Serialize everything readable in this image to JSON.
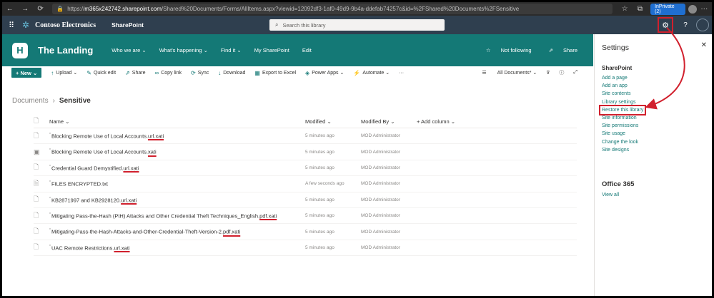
{
  "browser": {
    "url_host": "m365x242742.sharepoint.com",
    "url_path": "/Shared%20Documents/Forms/AllItems.aspx?viewid=12092df3-1af0-49d9-9b4a-ddefab74257c&id=%2FShared%20Documents%2FSensitive",
    "inprivate_label": "InPrivate (2)"
  },
  "suite": {
    "brand": "Contoso Electronics",
    "app": "SharePoint",
    "search_placeholder": "Search this library"
  },
  "site": {
    "logo_letter": "H",
    "title": "The Landing",
    "nav": [
      "Who we are",
      "What's happening",
      "Find it",
      "My SharePoint",
      "Edit"
    ],
    "follow_label": "Not following",
    "share_label": "Share"
  },
  "command_bar": {
    "new_label": "New",
    "commands": [
      "Upload",
      "Quick edit",
      "Share",
      "Copy link",
      "Sync",
      "Download",
      "Export to Excel",
      "Power Apps",
      "Automate",
      "···"
    ],
    "view_label": "All Documents*"
  },
  "breadcrumb": {
    "root": "Documents",
    "current": "Sensitive"
  },
  "table": {
    "headers": {
      "name": "Name",
      "modified": "Modified",
      "modified_by": "Modified By",
      "add_column": "+ Add column"
    },
    "rows": [
      {
        "base": "Blocking Remote Use of Local Accounts.",
        "ext": "url.xati",
        "modified": "5 minutes ago",
        "modified_by": "MOD Administrator",
        "icon": "file-icon"
      },
      {
        "base": "Blocking Remote Use of Local Accounts.",
        "ext": "xati",
        "modified": "5 minutes ago",
        "modified_by": "MOD Administrator",
        "icon": "image-file-icon"
      },
      {
        "base": "Credential Guard Demystified.",
        "ext": "url.xati",
        "modified": "5 minutes ago",
        "modified_by": "MOD Administrator",
        "icon": "file-icon"
      },
      {
        "base": "FILES ENCRYPTED.txt",
        "ext": "",
        "modified": "A few seconds ago",
        "modified_by": "MOD Administrator",
        "icon": "text-file-icon"
      },
      {
        "base": "KB2871997 and KB2928120.",
        "ext": "url.xati",
        "modified": "5 minutes ago",
        "modified_by": "MOD Administrator",
        "icon": "file-icon"
      },
      {
        "base": "Mitigating Pass-the-Hash (PtH) Attacks and Other Credential Theft Techniques_English.",
        "ext": "pdf.xati",
        "modified": "5 minutes ago",
        "modified_by": "MOD Administrator",
        "icon": "file-icon"
      },
      {
        "base": "Mitigating-Pass-the-Hash-Attacks-and-Other-Credential-Theft-Version-2.",
        "ext": "pdf.xati",
        "modified": "5 minutes ago",
        "modified_by": "MOD Administrator",
        "icon": "file-icon"
      },
      {
        "base": "UAC Remote Restrictions.",
        "ext": "url.xati",
        "modified": "5 minutes ago",
        "modified_by": "MOD Administrator",
        "icon": "file-icon"
      }
    ]
  },
  "settings": {
    "title": "Settings",
    "sharepoint_heading": "SharePoint",
    "links": [
      "Add a page",
      "Add an app",
      "Site contents",
      "Library settings",
      "Restore this library",
      "Site information",
      "Site permissions",
      "Site usage",
      "Change the look",
      "Site designs"
    ],
    "highlighted_link_index": 4,
    "office_heading": "Office 365",
    "view_all": "View all"
  },
  "colors": {
    "brand": "#147976",
    "suite": "#2f3f4f",
    "highlight": "#d1202d"
  }
}
